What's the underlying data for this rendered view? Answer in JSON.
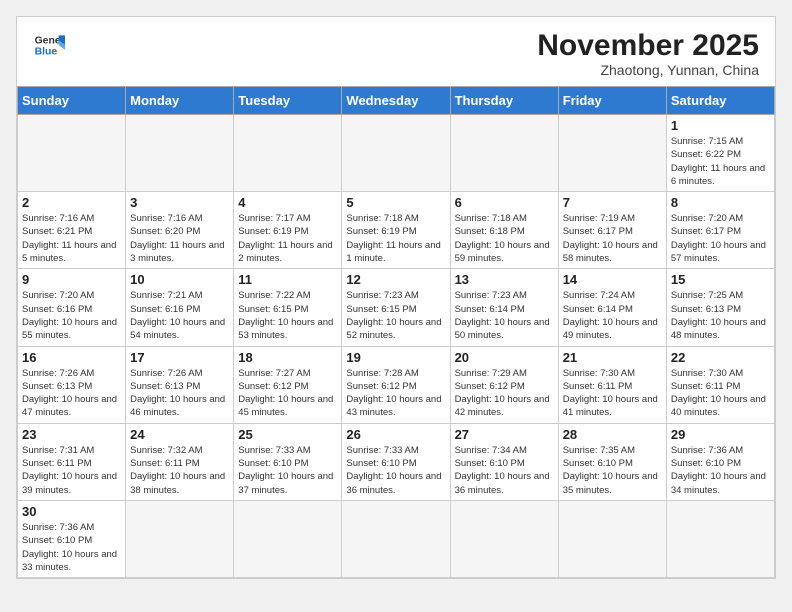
{
  "header": {
    "logo_general": "General",
    "logo_blue": "Blue",
    "month_year": "November 2025",
    "location": "Zhaotong, Yunnan, China"
  },
  "weekdays": [
    "Sunday",
    "Monday",
    "Tuesday",
    "Wednesday",
    "Thursday",
    "Friday",
    "Saturday"
  ],
  "days": [
    {
      "date": "",
      "info": ""
    },
    {
      "date": "",
      "info": ""
    },
    {
      "date": "",
      "info": ""
    },
    {
      "date": "",
      "info": ""
    },
    {
      "date": "",
      "info": ""
    },
    {
      "date": "",
      "info": ""
    },
    {
      "date": "1",
      "info": "Sunrise: 7:15 AM\nSunset: 6:22 PM\nDaylight: 11 hours and 6 minutes."
    },
    {
      "date": "2",
      "info": "Sunrise: 7:16 AM\nSunset: 6:21 PM\nDaylight: 11 hours and 5 minutes."
    },
    {
      "date": "3",
      "info": "Sunrise: 7:16 AM\nSunset: 6:20 PM\nDaylight: 11 hours and 3 minutes."
    },
    {
      "date": "4",
      "info": "Sunrise: 7:17 AM\nSunset: 6:19 PM\nDaylight: 11 hours and 2 minutes."
    },
    {
      "date": "5",
      "info": "Sunrise: 7:18 AM\nSunset: 6:19 PM\nDaylight: 11 hours and 1 minute."
    },
    {
      "date": "6",
      "info": "Sunrise: 7:18 AM\nSunset: 6:18 PM\nDaylight: 10 hours and 59 minutes."
    },
    {
      "date": "7",
      "info": "Sunrise: 7:19 AM\nSunset: 6:17 PM\nDaylight: 10 hours and 58 minutes."
    },
    {
      "date": "8",
      "info": "Sunrise: 7:20 AM\nSunset: 6:17 PM\nDaylight: 10 hours and 57 minutes."
    },
    {
      "date": "9",
      "info": "Sunrise: 7:20 AM\nSunset: 6:16 PM\nDaylight: 10 hours and 55 minutes."
    },
    {
      "date": "10",
      "info": "Sunrise: 7:21 AM\nSunset: 6:16 PM\nDaylight: 10 hours and 54 minutes."
    },
    {
      "date": "11",
      "info": "Sunrise: 7:22 AM\nSunset: 6:15 PM\nDaylight: 10 hours and 53 minutes."
    },
    {
      "date": "12",
      "info": "Sunrise: 7:23 AM\nSunset: 6:15 PM\nDaylight: 10 hours and 52 minutes."
    },
    {
      "date": "13",
      "info": "Sunrise: 7:23 AM\nSunset: 6:14 PM\nDaylight: 10 hours and 50 minutes."
    },
    {
      "date": "14",
      "info": "Sunrise: 7:24 AM\nSunset: 6:14 PM\nDaylight: 10 hours and 49 minutes."
    },
    {
      "date": "15",
      "info": "Sunrise: 7:25 AM\nSunset: 6:13 PM\nDaylight: 10 hours and 48 minutes."
    },
    {
      "date": "16",
      "info": "Sunrise: 7:26 AM\nSunset: 6:13 PM\nDaylight: 10 hours and 47 minutes."
    },
    {
      "date": "17",
      "info": "Sunrise: 7:26 AM\nSunset: 6:13 PM\nDaylight: 10 hours and 46 minutes."
    },
    {
      "date": "18",
      "info": "Sunrise: 7:27 AM\nSunset: 6:12 PM\nDaylight: 10 hours and 45 minutes."
    },
    {
      "date": "19",
      "info": "Sunrise: 7:28 AM\nSunset: 6:12 PM\nDaylight: 10 hours and 43 minutes."
    },
    {
      "date": "20",
      "info": "Sunrise: 7:29 AM\nSunset: 6:12 PM\nDaylight: 10 hours and 42 minutes."
    },
    {
      "date": "21",
      "info": "Sunrise: 7:30 AM\nSunset: 6:11 PM\nDaylight: 10 hours and 41 minutes."
    },
    {
      "date": "22",
      "info": "Sunrise: 7:30 AM\nSunset: 6:11 PM\nDaylight: 10 hours and 40 minutes."
    },
    {
      "date": "23",
      "info": "Sunrise: 7:31 AM\nSunset: 6:11 PM\nDaylight: 10 hours and 39 minutes."
    },
    {
      "date": "24",
      "info": "Sunrise: 7:32 AM\nSunset: 6:11 PM\nDaylight: 10 hours and 38 minutes."
    },
    {
      "date": "25",
      "info": "Sunrise: 7:33 AM\nSunset: 6:10 PM\nDaylight: 10 hours and 37 minutes."
    },
    {
      "date": "26",
      "info": "Sunrise: 7:33 AM\nSunset: 6:10 PM\nDaylight: 10 hours and 36 minutes."
    },
    {
      "date": "27",
      "info": "Sunrise: 7:34 AM\nSunset: 6:10 PM\nDaylight: 10 hours and 36 minutes."
    },
    {
      "date": "28",
      "info": "Sunrise: 7:35 AM\nSunset: 6:10 PM\nDaylight: 10 hours and 35 minutes."
    },
    {
      "date": "29",
      "info": "Sunrise: 7:36 AM\nSunset: 6:10 PM\nDaylight: 10 hours and 34 minutes."
    },
    {
      "date": "30",
      "info": "Sunrise: 7:36 AM\nSunset: 6:10 PM\nDaylight: 10 hours and 33 minutes."
    },
    {
      "date": "",
      "info": ""
    },
    {
      "date": "",
      "info": ""
    },
    {
      "date": "",
      "info": ""
    },
    {
      "date": "",
      "info": ""
    },
    {
      "date": "",
      "info": ""
    },
    {
      "date": "",
      "info": ""
    }
  ]
}
